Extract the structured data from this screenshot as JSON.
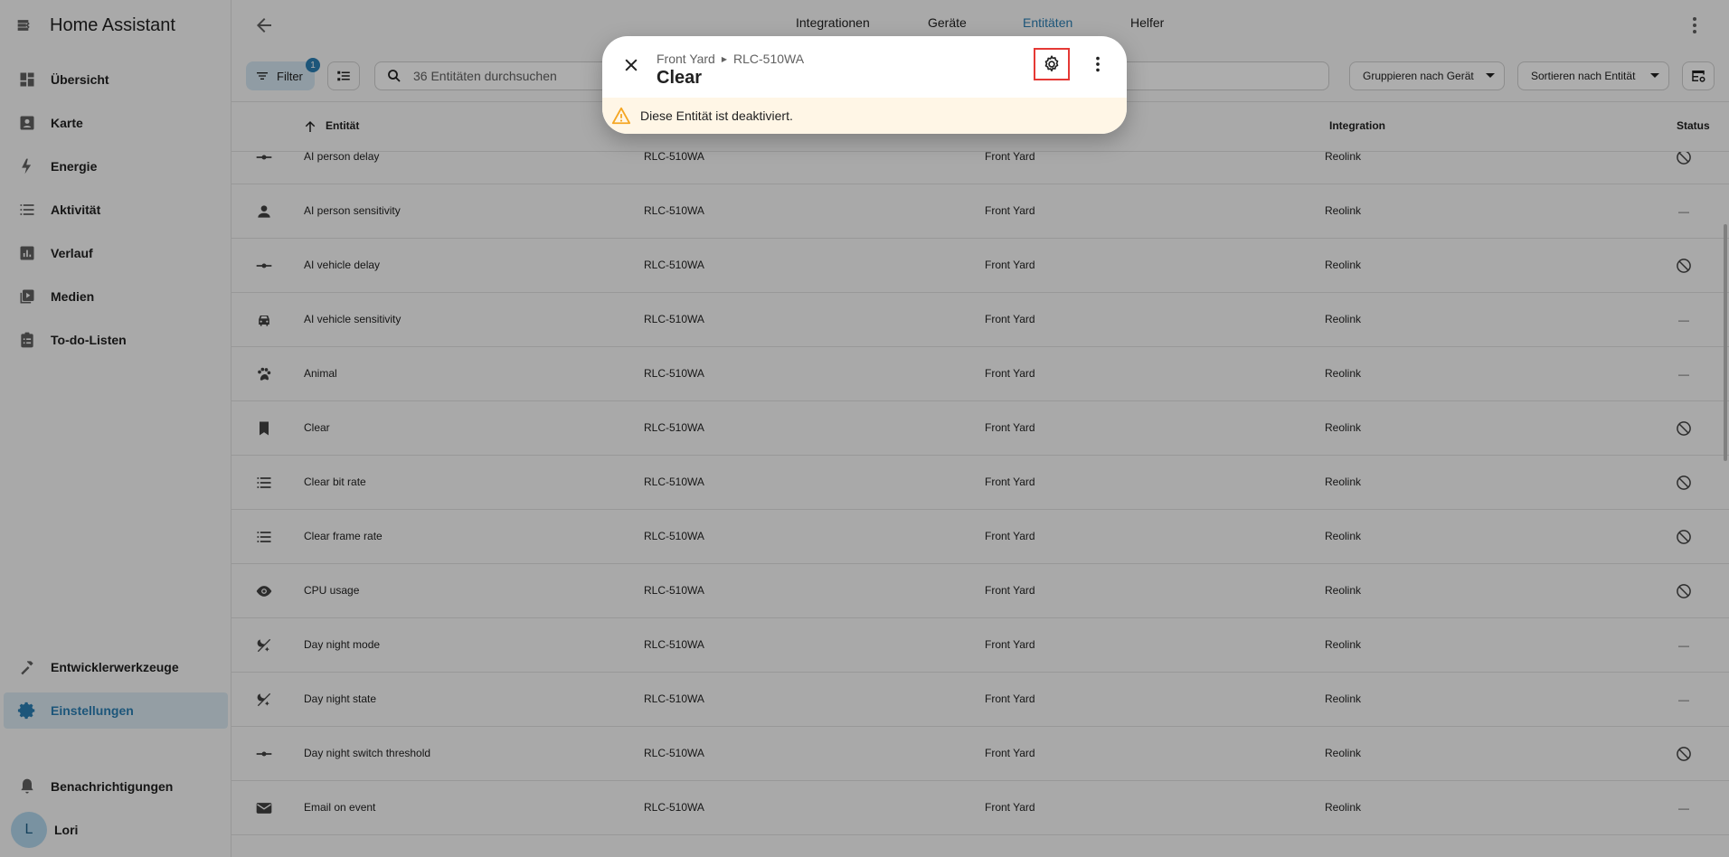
{
  "app": {
    "title": "Home Assistant"
  },
  "sidebar": {
    "items": [
      {
        "label": "Übersicht",
        "icon": "dashboard-icon"
      },
      {
        "label": "Karte",
        "icon": "map-account-icon"
      },
      {
        "label": "Energie",
        "icon": "lightning-bolt-icon"
      },
      {
        "label": "Aktivität",
        "icon": "format-list-icon"
      },
      {
        "label": "Verlauf",
        "icon": "chart-box-icon"
      },
      {
        "label": "Medien",
        "icon": "play-box-multiple-icon"
      },
      {
        "label": "To-do-Listen",
        "icon": "clipboard-list-icon"
      }
    ],
    "bottom_items": [
      {
        "label": "Entwicklerwerkzeuge",
        "icon": "hammer-icon"
      },
      {
        "label": "Einstellungen",
        "icon": "cog-icon"
      }
    ],
    "notifications": "Benachrichtigungen",
    "user": {
      "name": "Lori",
      "initial": "L"
    }
  },
  "tabs": [
    {
      "label": "Integrationen"
    },
    {
      "label": "Geräte"
    },
    {
      "label": "Entitäten"
    },
    {
      "label": "Helfer"
    }
  ],
  "toolbar": {
    "filter_label": "Filter",
    "filter_count": "1",
    "search_placeholder": "36 Entitäten durchsuchen",
    "group_by": "Gruppieren nach Gerät",
    "sort_by": "Sortieren nach Entität"
  },
  "table": {
    "headers": {
      "entity": "Entität",
      "integration": "Integration",
      "status": "Status"
    },
    "rows": [
      {
        "icon": "slider-icon",
        "name": "AI person delay",
        "device": "RLC-510WA",
        "area": "Front Yard",
        "integration": "Reolink",
        "status": "disabled"
      },
      {
        "icon": "person-icon",
        "name": "AI person sensitivity",
        "device": "RLC-510WA",
        "area": "Front Yard",
        "integration": "Reolink",
        "status": "—"
      },
      {
        "icon": "slider-icon",
        "name": "AI vehicle delay",
        "device": "RLC-510WA",
        "area": "Front Yard",
        "integration": "Reolink",
        "status": "disabled"
      },
      {
        "icon": "car-icon",
        "name": "AI vehicle sensitivity",
        "device": "RLC-510WA",
        "area": "Front Yard",
        "integration": "Reolink",
        "status": "—"
      },
      {
        "icon": "paw-icon",
        "name": "Animal",
        "device": "RLC-510WA",
        "area": "Front Yard",
        "integration": "Reolink",
        "status": "—"
      },
      {
        "icon": "bookmark-icon",
        "name": "Clear",
        "device": "RLC-510WA",
        "area": "Front Yard",
        "integration": "Reolink",
        "status": "disabled"
      },
      {
        "icon": "list-icon",
        "name": "Clear bit rate",
        "device": "RLC-510WA",
        "area": "Front Yard",
        "integration": "Reolink",
        "status": "disabled"
      },
      {
        "icon": "list-icon",
        "name": "Clear frame rate",
        "device": "RLC-510WA",
        "area": "Front Yard",
        "integration": "Reolink",
        "status": "disabled"
      },
      {
        "icon": "eye-icon",
        "name": "CPU usage",
        "device": "RLC-510WA",
        "area": "Front Yard",
        "integration": "Reolink",
        "status": "disabled"
      },
      {
        "icon": "weather-night-icon",
        "name": "Day night mode",
        "device": "RLC-510WA",
        "area": "Front Yard",
        "integration": "Reolink",
        "status": "—"
      },
      {
        "icon": "weather-night-icon",
        "name": "Day night state",
        "device": "RLC-510WA",
        "area": "Front Yard",
        "integration": "Reolink",
        "status": "—"
      },
      {
        "icon": "slider-icon",
        "name": "Day night switch threshold",
        "device": "RLC-510WA",
        "area": "Front Yard",
        "integration": "Reolink",
        "status": "disabled"
      },
      {
        "icon": "email-icon",
        "name": "Email on event",
        "device": "RLC-510WA",
        "area": "Front Yard",
        "integration": "Reolink",
        "status": "—"
      }
    ]
  },
  "dialog": {
    "breadcrumb_area": "Front Yard",
    "breadcrumb_device": "RLC-510WA",
    "title": "Clear",
    "warning": "Diese Entität ist deaktiviert."
  },
  "colors": {
    "accent": "#2b7fb4",
    "highlight_border": "#e53935",
    "warning_bg": "#fff6e6",
    "warning_icon": "#f5a623"
  }
}
